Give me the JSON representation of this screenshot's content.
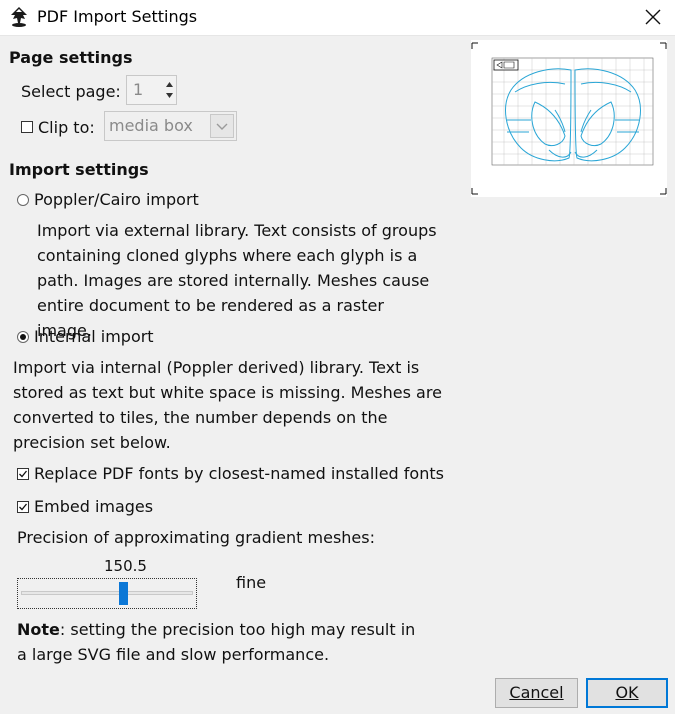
{
  "window": {
    "title": "PDF Import Settings"
  },
  "page_settings": {
    "heading": "Page settings",
    "select_page_label": "Select page:",
    "select_page_value": "1",
    "clip_to_label": "Clip to:",
    "clip_to_checked": false,
    "clip_to_value": "media box"
  },
  "import_settings": {
    "heading": "Import settings",
    "options": [
      {
        "label": "Poppler/Cairo import",
        "selected": false,
        "description": "Import via external library. Text consists of groups containing cloned glyphs where each glyph is a path. Images are stored internally. Meshes cause entire document to be rendered as a raster image."
      },
      {
        "label": "Internal import",
        "selected": true,
        "description": "Import via internal (Poppler derived) library. Text is stored as text but white space is missing. Meshes are converted to tiles, the number depends on the precision set below."
      }
    ],
    "replace_fonts_label": "Replace PDF fonts by closest-named installed fonts",
    "replace_fonts_checked": true,
    "embed_images_label": "Embed images",
    "embed_images_checked": true,
    "precision_label": "Precision of approximating gradient meshes:",
    "precision_value": "150.5",
    "precision_level": "fine",
    "note_bold": "Note",
    "note_text": ": setting the precision too high may result in a large SVG file and slow performance."
  },
  "buttons": {
    "cancel": "Cancel",
    "ok": "OK"
  },
  "colors": {
    "accent": "#0078d7",
    "slider_thumb": "#0b77d6",
    "preview_line": "#2aa6d6"
  },
  "icons": {
    "app": "inkscape-logo-icon",
    "close": "close-icon"
  }
}
